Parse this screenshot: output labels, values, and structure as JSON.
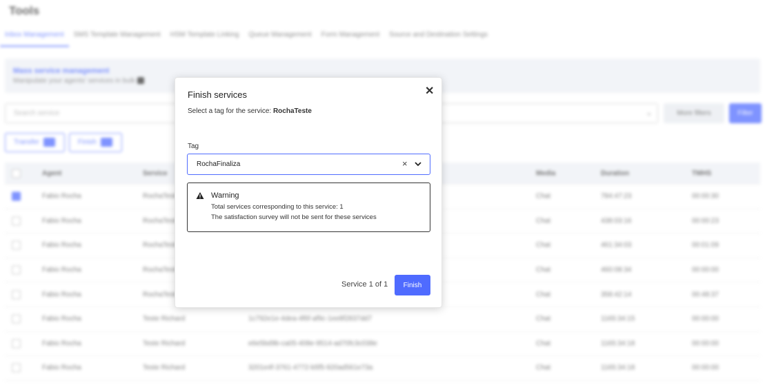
{
  "page": {
    "title": "Tools",
    "tabs": [
      {
        "label": "Inbox Management",
        "active": true
      },
      {
        "label": "SMS Template Management",
        "active": false
      },
      {
        "label": "HSM Template Linking",
        "active": false
      },
      {
        "label": "Queue Management",
        "active": false
      },
      {
        "label": "Form Management",
        "active": false
      },
      {
        "label": "Source and Destination Settings",
        "active": false
      }
    ]
  },
  "banner": {
    "title": "Mass service management",
    "subtitle": "Manipulate your agents' services in bulk"
  },
  "filters": {
    "search_placeholder": "Search service",
    "more_filters_label": "More filters",
    "filter_label": "Filter"
  },
  "actions": {
    "transfer_label": "Transfer",
    "finish_label": "Finish"
  },
  "table": {
    "columns": [
      "Agent",
      "Service",
      "Media",
      "Duration",
      "TMHS"
    ],
    "rows": [
      {
        "checked": true,
        "agent": "Fabio Rocha",
        "service": "RochaTeste",
        "id": "",
        "media": "Chat",
        "duration": "784:47:23",
        "tmhs": "00:00:30"
      },
      {
        "checked": false,
        "agent": "Fabio Rocha",
        "service": "RochaTeste",
        "id": "",
        "media": "Chat",
        "duration": "438:03:16",
        "tmhs": "00:00:23"
      },
      {
        "checked": false,
        "agent": "Fabio Rocha",
        "service": "RochaTeste",
        "id": "",
        "media": "Chat",
        "duration": "461:34:03",
        "tmhs": "00:01:09"
      },
      {
        "checked": false,
        "agent": "Fabio Rocha",
        "service": "RochaTeste",
        "id": "",
        "media": "Chat",
        "duration": "460:08:34",
        "tmhs": "00:00:00"
      },
      {
        "checked": false,
        "agent": "Fabio Rocha",
        "service": "RochaTeste",
        "id": "",
        "media": "Chat",
        "duration": "358:42:14",
        "tmhs": "00:48:37"
      },
      {
        "checked": false,
        "agent": "Fabio Rocha",
        "service": "Teste Richard",
        "id": "1c792e1e-4dea-4f6f-af9c-1ee8f2837dd7",
        "media": "Chat",
        "duration": "1165:34:15",
        "tmhs": "00:00:00"
      },
      {
        "checked": false,
        "agent": "Fabio Rocha",
        "service": "Teste Richard",
        "id": "e6e5bd9b-ca05-408e-9514-ad70fc3c038e",
        "media": "Chat",
        "duration": "1165:34:18",
        "tmhs": "00:00:00"
      },
      {
        "checked": false,
        "agent": "Fabio Rocha",
        "service": "Teste Richard",
        "id": "3201e4f-3761-4772-b5f5-920ad561e73a",
        "media": "Chat",
        "duration": "1165:34:18",
        "tmhs": "00:00:00"
      }
    ]
  },
  "modal": {
    "title": "Finish services",
    "subtitle_prefix": "Select a tag for the service: ",
    "service_name": "RochaTeste",
    "tag_label": "Tag",
    "tag_value": "RochaFinaliza",
    "warning": {
      "title": "Warning",
      "line1": "Total services corresponding to this service: 1",
      "line2": "The satisfaction survey will not be sent for these services"
    },
    "pager": "Service 1 of 1",
    "finish_label": "Finish",
    "close_glyph": "✕",
    "clear_glyph": "×"
  },
  "colors": {
    "accent": "#4f6bff",
    "banner_bg": "#eef1f6"
  }
}
